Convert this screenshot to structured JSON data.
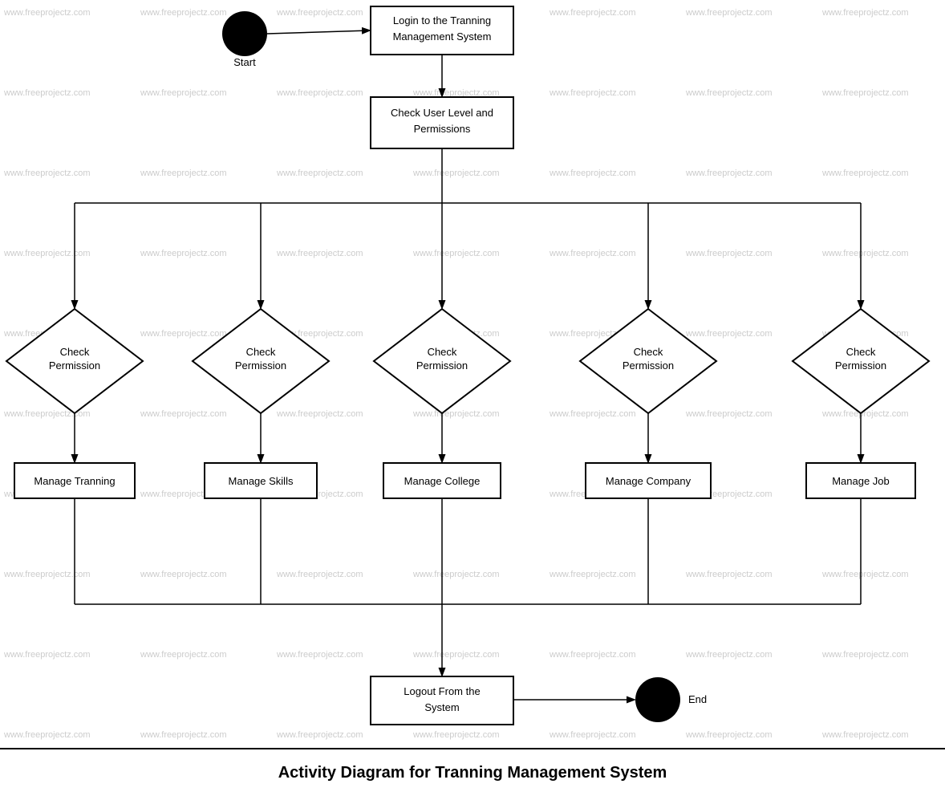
{
  "diagram": {
    "title": "Activity Diagram for Tranning Management System",
    "watermark": "www.freeprojectz.com",
    "nodes": {
      "start": {
        "label": "Start",
        "type": "circle"
      },
      "login": {
        "label": "Login to the Tranning\nManagement System",
        "type": "rect"
      },
      "checkUserLevel": {
        "label": "Check User Level and\nPermissions",
        "type": "rect"
      },
      "checkPerm1": {
        "label": "Check\nPermission",
        "type": "diamond"
      },
      "checkPerm2": {
        "label": "Check\nPermission",
        "type": "diamond"
      },
      "checkPerm3": {
        "label": "Check\nPermission",
        "type": "diamond"
      },
      "checkPerm4": {
        "label": "Check\nPermission",
        "type": "diamond"
      },
      "checkPerm5": {
        "label": "Check\nPermission",
        "type": "diamond"
      },
      "manageTraining": {
        "label": "Manage Tranning",
        "type": "rect"
      },
      "manageSkills": {
        "label": "Manage Skills",
        "type": "rect"
      },
      "manageCollege": {
        "label": "Manage College",
        "type": "rect"
      },
      "manageCompany": {
        "label": "Manage Company",
        "type": "rect"
      },
      "manageJob": {
        "label": "Manage Job",
        "type": "rect"
      },
      "logout": {
        "label": "Logout From the\nSystem",
        "type": "rect"
      },
      "end": {
        "label": "End",
        "type": "circle"
      }
    }
  }
}
